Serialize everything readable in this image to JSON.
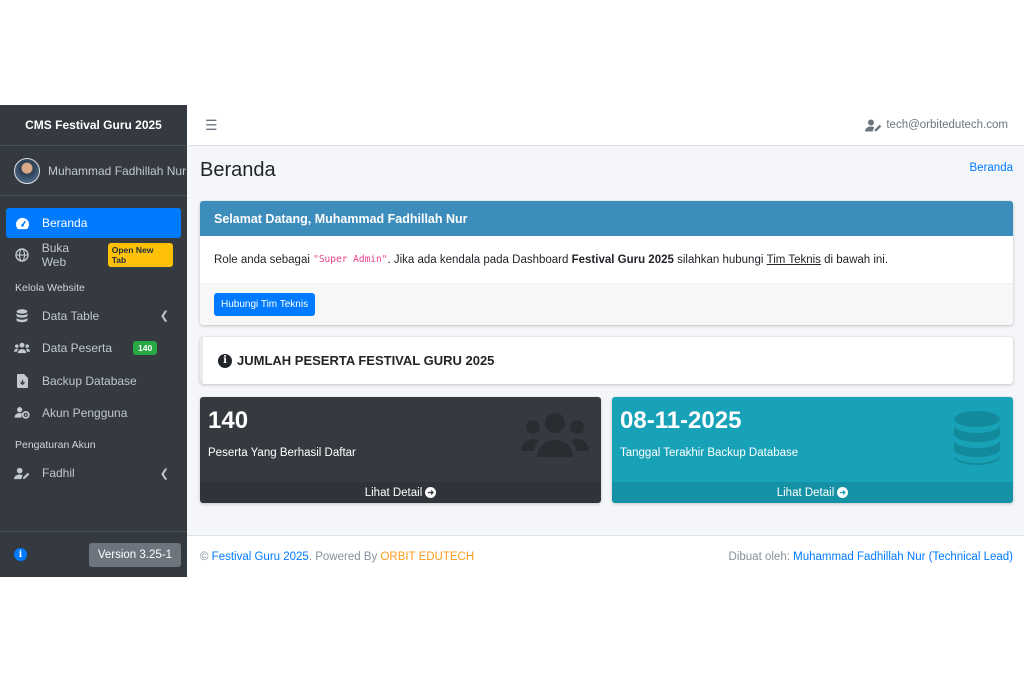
{
  "sidebar": {
    "brand": "CMS Festival Guru 2025",
    "user_name": "Muhammad Fadhillah Nur",
    "items": [
      {
        "label": "Beranda"
      },
      {
        "label": "Buka Web",
        "badge": "Open New Tab"
      },
      {
        "header": "Kelola Website"
      },
      {
        "label": "Data Table"
      },
      {
        "label": "Data Peserta",
        "badge": "140"
      },
      {
        "label": "Backup Database"
      },
      {
        "label": "Akun Pengguna"
      },
      {
        "header": "Pengaturan Akun"
      },
      {
        "label": "Fadhil"
      }
    ],
    "version": "Version 3.25-1"
  },
  "navbar": {
    "user_email": "tech@orbitedutech.com"
  },
  "page": {
    "title": "Beranda",
    "breadcrumb": "Beranda"
  },
  "welcome": {
    "title": "Selamat Datang, Muhammad Fadhillah Nur",
    "text_1": "Role anda sebagai ",
    "role": "\"Super Admin\"",
    "text_2": ". Jika ada kendala pada Dashboard ",
    "app_name": "Festival Guru 2025",
    "text_3": " silahkan hubungi ",
    "link": "Tim Teknis",
    "text_4": " di bawah ini.",
    "button": "Hubungi Tim Teknis"
  },
  "count_card": {
    "title": "JUMLAH PESERTA FESTIVAL GURU 2025"
  },
  "stats": [
    {
      "value": "140",
      "label": "Peserta Yang Berhasil Daftar",
      "footer": "Lihat Detail",
      "icon": "users-icon"
    },
    {
      "value": "08-11-2025",
      "label": "Tanggal Terakhir Backup Database",
      "footer": "Lihat Detail",
      "icon": "database-icon"
    }
  ],
  "footer": {
    "copy": "© ",
    "site": "Festival Guru 2025",
    "powered": ". Powered By ",
    "company": "ORBIT EDUTECH",
    "made_by": "Dibuat oleh: ",
    "author": "Muhammad Fadhillah Nur (Technical Lead)"
  },
  "colors": {
    "sidebar": "#343a40",
    "primary": "#007bff",
    "card_header": "#3c8dbc",
    "info": "#17a2b8",
    "accent_orange": "#fd9a1e"
  }
}
